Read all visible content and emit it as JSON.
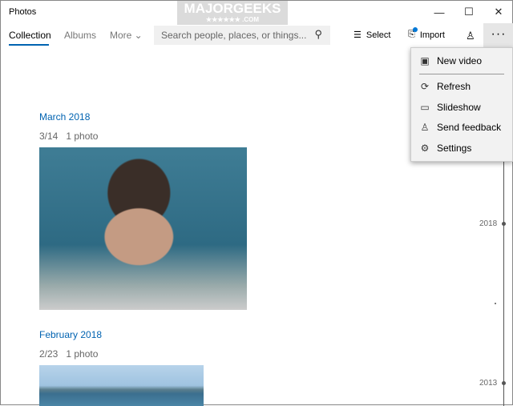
{
  "window": {
    "title": "Photos",
    "minimize": "—",
    "maximize": "☐",
    "close": "✕"
  },
  "watermark": {
    "text": "MAJORGEEKS",
    "sub": "★★★★★★ .COM"
  },
  "nav": {
    "tabs": [
      {
        "label": "Collection"
      },
      {
        "label": "Albums"
      },
      {
        "label": "More ⌄"
      }
    ]
  },
  "search": {
    "placeholder": "Search people, places, or things..."
  },
  "toolbar": {
    "select": "Select",
    "import": "Import",
    "more": "···"
  },
  "menu": {
    "items": [
      {
        "label": "New video",
        "icon": "new-video-icon"
      },
      {
        "label": "Refresh",
        "icon": "refresh-icon"
      },
      {
        "label": "Slideshow",
        "icon": "slideshow-icon"
      },
      {
        "label": "Send feedback",
        "icon": "feedback-icon"
      },
      {
        "label": "Settings",
        "icon": "gear-icon"
      }
    ]
  },
  "groups": [
    {
      "month": "March 2018",
      "date": "3/14",
      "count": "1 photo"
    },
    {
      "month": "February 2018",
      "date": "2/23",
      "count": "1 photo"
    }
  ],
  "timeline": {
    "years": [
      "2018",
      "2013"
    ]
  }
}
